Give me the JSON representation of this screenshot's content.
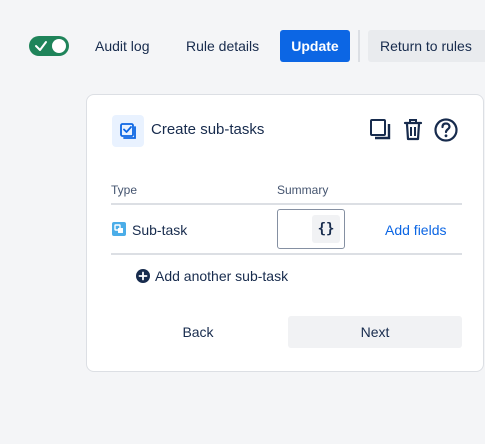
{
  "toolbar": {
    "toggle_enabled": true,
    "audit_log_label": "Audit log",
    "rule_details_label": "Rule details",
    "update_label": "Update",
    "return_label": "Return to rules"
  },
  "card": {
    "title": "Create sub-tasks",
    "actions": [
      "copy-icon",
      "trash-icon",
      "help-icon"
    ],
    "columns": {
      "type": "Type",
      "summary": "Summary"
    },
    "rows": [
      {
        "type": "Sub-task",
        "summary": "",
        "smart_value_label": "{}",
        "add_fields": "Add fields"
      }
    ],
    "add_another_label": "Add another sub-task",
    "back_label": "Back",
    "next_label": "Next"
  },
  "colors": {
    "toggle_on": "#1f845a",
    "primary": "#0c66e4",
    "link": "#0c66e4",
    "subtask_icon": "#4bade8"
  }
}
